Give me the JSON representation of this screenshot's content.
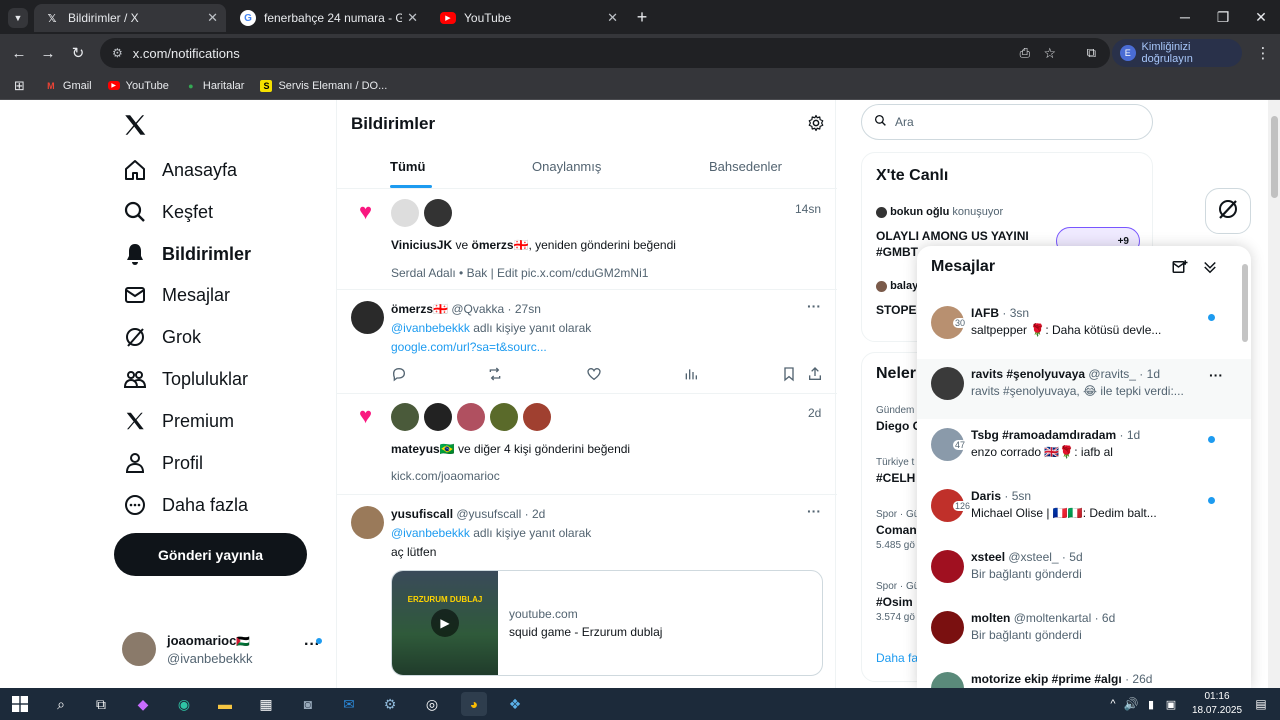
{
  "browser": {
    "tabs": [
      {
        "title": "Bildirimler / X",
        "icon": "x-logo-icon",
        "active": true
      },
      {
        "title": "fenerbahçe 24 numara - Google",
        "icon": "google-icon",
        "active": false
      },
      {
        "title": "YouTube",
        "icon": "youtube-icon",
        "active": false
      }
    ],
    "url": "x.com/notifications",
    "verify_label": "Kimliğinizi doğrulayın",
    "verify_initial": "E",
    "bookmarks": [
      {
        "label": "Gmail",
        "icon": "gmail-icon"
      },
      {
        "label": "YouTube",
        "icon": "youtube-icon"
      },
      {
        "label": "Haritalar",
        "icon": "maps-icon"
      },
      {
        "label": "Servis Elemanı / DO...",
        "icon": "s-badge-icon"
      }
    ]
  },
  "nav": {
    "items": [
      {
        "label": "Anasayfa",
        "icon": "home-icon"
      },
      {
        "label": "Keşfet",
        "icon": "search-icon"
      },
      {
        "label": "Bildirimler",
        "icon": "bell-icon",
        "active": true
      },
      {
        "label": "Mesajlar",
        "icon": "mail-icon"
      },
      {
        "label": "Grok",
        "icon": "grok-icon"
      },
      {
        "label": "Topluluklar",
        "icon": "communities-icon"
      },
      {
        "label": "Premium",
        "icon": "x-logo-icon"
      },
      {
        "label": "Profil",
        "icon": "person-icon"
      },
      {
        "label": "Daha fazla",
        "icon": "more-circle-icon"
      }
    ],
    "post_button": "Gönderi yayınla",
    "account": {
      "name": "joaomarioc",
      "flag": "🇵🇸",
      "handle": "@ivanbebekkk"
    }
  },
  "main": {
    "title": "Bildirimler",
    "tabs": [
      "Tümü",
      "Onaylanmış",
      "Bahsedenler"
    ],
    "items": [
      {
        "type": "like",
        "time": "14sn",
        "actors_a": "ViniciusJK",
        "joiner": " ve ",
        "actors_b": "ömerzs🇬🇪",
        "action": ", yeniden gönderini beğendi",
        "preview": "Serdal Adalı • Bak | Edit pic.x.com/cduGM2mNi1"
      },
      {
        "type": "reply",
        "name": "ömerzs🇬🇪",
        "handle": "@Qvakka",
        "time": "27sn",
        "mention": "@ivanbebekkk",
        "mention_suffix": " adlı kişiye yanıt olarak",
        "text": "google.com/url?sa=t&sourc..."
      },
      {
        "type": "like",
        "time": "2d",
        "actors_a": "mateyus🇧🇷",
        "action": " ve diğer 4 kişi gönderini beğendi",
        "preview": "kick.com/joaomarioc"
      },
      {
        "type": "reply",
        "name": "yusufiscall",
        "handle": "@yusufscall",
        "time": "2d",
        "mention": "@ivanbebekkk",
        "mention_suffix": " adlı kişiye yanıt olarak",
        "text": "aç lütfen",
        "card": {
          "site": "youtube.com",
          "title": "squid game - Erzurum dublaj",
          "thumb_text": "ERZURUM DUBLAJ"
        }
      }
    ]
  },
  "right": {
    "search_placeholder": "Ara",
    "live": {
      "title": "X'te Canlı",
      "host": "bokun oğlu",
      "host_status": "konuşuyor",
      "space_title": "OLAYLI AMONG US YAYINI #GMBT",
      "listeners": "+9",
      "host2": "balay",
      "space2": "STOPE"
    },
    "trends": {
      "title": "Neler",
      "rows": [
        {
          "meta": "Gündem",
          "name": "Diego C"
        },
        {
          "meta": "Türkiye t",
          "name": "#CELH"
        },
        {
          "meta": "Spor · Gü",
          "name": "Coman",
          "count": "5.485 gö"
        },
        {
          "meta": "Spor · Gü",
          "name": "#Osim",
          "count": "3.574 gö"
        }
      ],
      "more": "Daha fa"
    }
  },
  "messages": {
    "title": "Mesajlar",
    "rows": [
      {
        "name": "IAFB",
        "handle": "",
        "time": "3sn",
        "text": "saltpepper 🌹: Daha kötüsü devle...",
        "unread": true,
        "badge": "30"
      },
      {
        "name": "ravits #şenolyuvaya",
        "handle": "@ravits_",
        "time": "1d",
        "text": "ravits #şenolyuvaya, 😂 ile tepki verdi:...",
        "unread": false,
        "badge": ""
      },
      {
        "name": "Tsbg #ramoadamdıradam",
        "handle": "",
        "time": "1d",
        "text": "enzo corrado 🇬🇧🌹: iafb al",
        "unread": true,
        "badge": "47"
      },
      {
        "name": "Daris",
        "handle": "",
        "time": "5sn",
        "text": "Michael Olise | 🇫🇷🇮🇹: Dedim balt...",
        "unread": true,
        "badge": "126"
      },
      {
        "name": "xsteel",
        "handle": "@xsteel_",
        "time": "5d",
        "text": "Bir bağlantı gönderdi",
        "unread": false,
        "badge": ""
      },
      {
        "name": "molten",
        "handle": "@moltenkartal",
        "time": "6d",
        "text": "Bir bağlantı gönderdi",
        "unread": false,
        "badge": ""
      },
      {
        "name": "motorize ekip #prime #algı",
        "handle": "",
        "time": "26d",
        "text": "",
        "unread": false,
        "badge": ""
      }
    ]
  },
  "taskbar": {
    "time": "01:16",
    "date": "18.07.2025"
  },
  "colors": {
    "x_blue": "#1d9bf0",
    "like_pink": "#f91880",
    "chrome_dark": "#202124",
    "taskbar": "#1c2a3a"
  }
}
